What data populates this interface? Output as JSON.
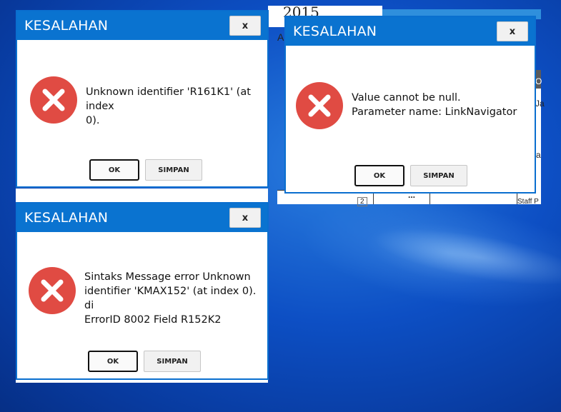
{
  "desktop": {},
  "background_window": {
    "year": "2015",
    "fragment_a": "A",
    "fragment_o": "O",
    "fragment_ja": "Ja",
    "fragment_a2": "a",
    "fragment_staff": "Staff P",
    "fragment_dots": "...",
    "fragment_num": "2"
  },
  "dialogs": [
    {
      "title": "KESALAHAN",
      "close_label": "x",
      "message": "Unknown identifier 'R161K1' (at index\n0).",
      "ok_label": "OK",
      "save_label": "SIMPAN"
    },
    {
      "title": "KESALAHAN",
      "close_label": "x",
      "message": "Value cannot be null.\nParameter name: LinkNavigator",
      "ok_label": "OK",
      "save_label": "SIMPAN"
    },
    {
      "title": "KESALAHAN",
      "close_label": "x",
      "message": "Sintaks Message error Unknown\nidentifier 'KMAX152' (at index 0). di\nErrorID 8002 Field R152K2",
      "ok_label": "OK",
      "save_label": "SIMPAN"
    }
  ],
  "icons": {
    "error": "error-x-icon"
  },
  "colors": {
    "titlebar": "#0a73d0",
    "error_red": "#e04b43"
  }
}
